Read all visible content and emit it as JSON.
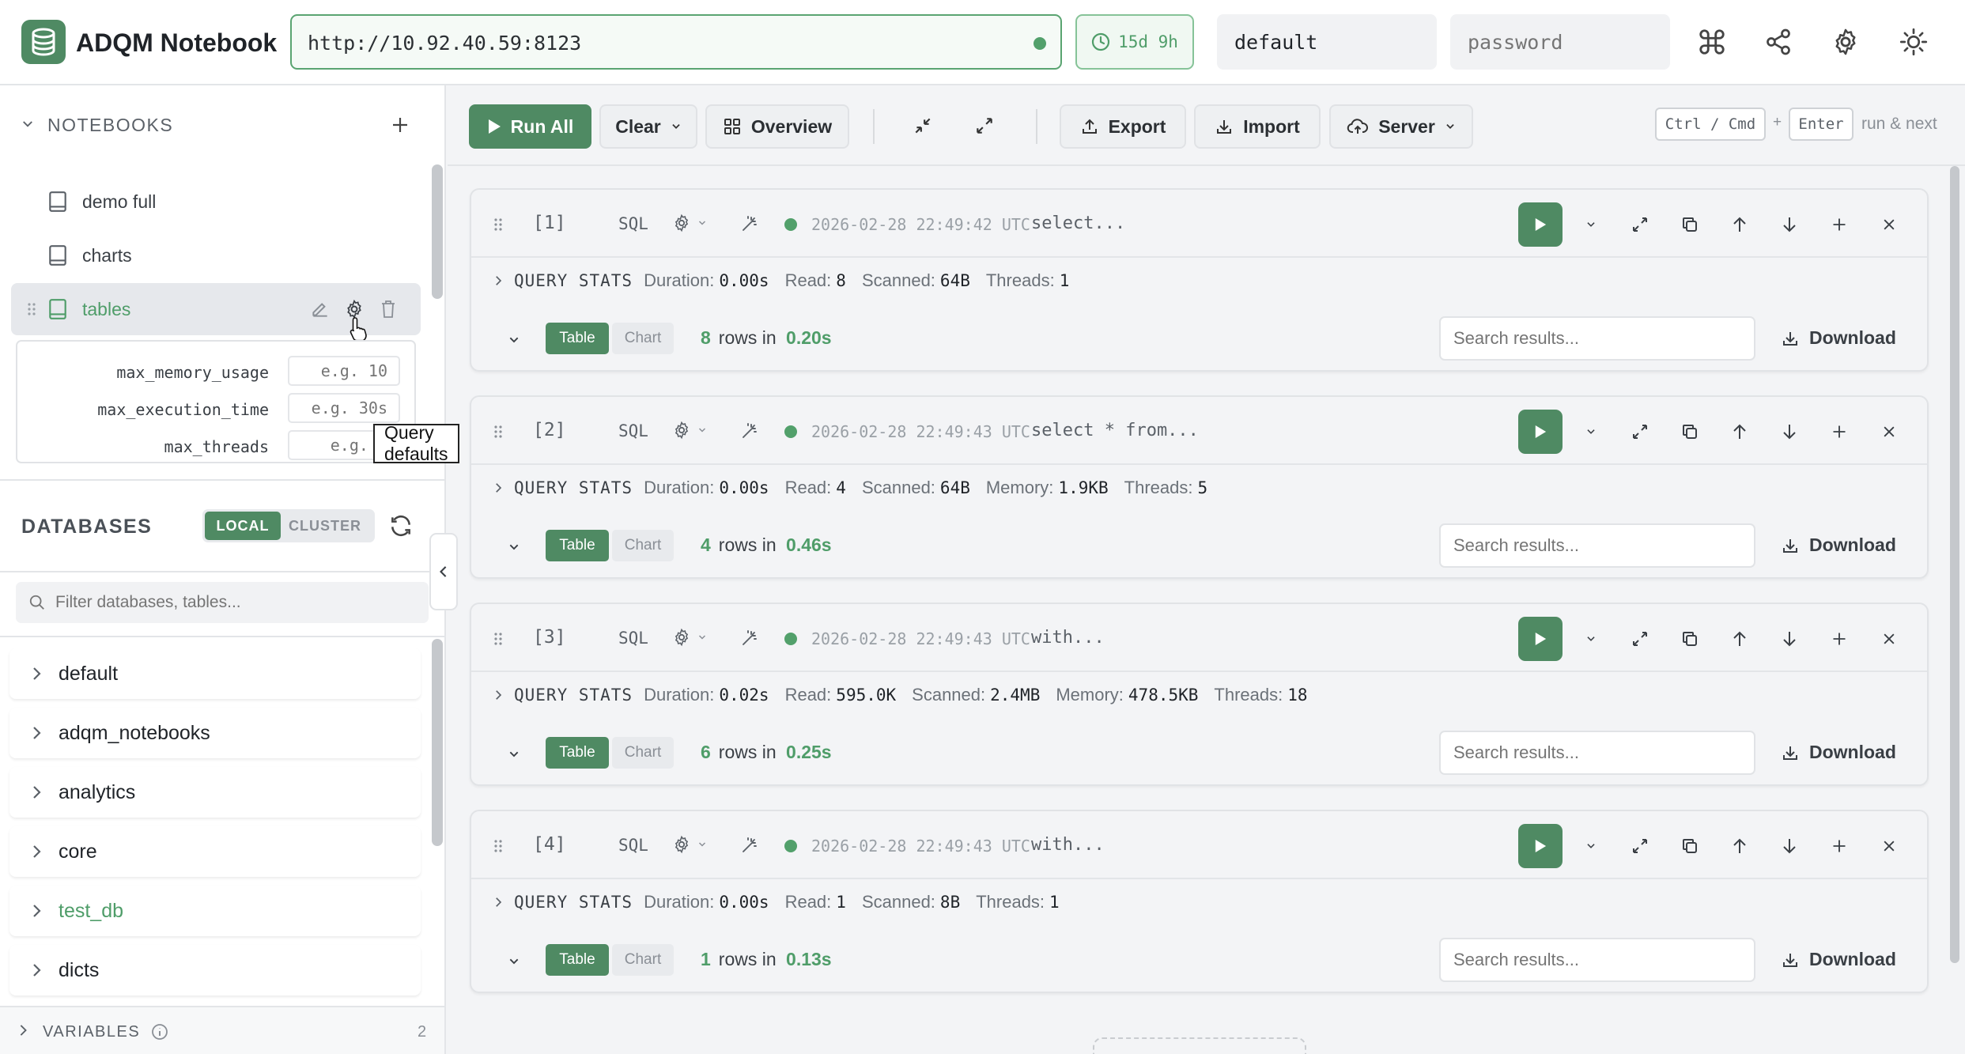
{
  "app": {
    "title": "ADQM Notebook"
  },
  "header": {
    "url": "http://10.92.40.59:8123",
    "uptime": "15d 9h",
    "username": "default",
    "password_placeholder": "password",
    "icons": [
      "command-icon",
      "share-icon",
      "settings-icon",
      "theme-sun-icon"
    ]
  },
  "sidebar": {
    "notebooks_title": "NOTEBOOKS",
    "notebooks": [
      {
        "label": "demo full"
      },
      {
        "label": "charts"
      },
      {
        "label": "tables",
        "active": true
      }
    ],
    "query_defaults": [
      {
        "key": "max_memory_usage",
        "placeholder": "e.g. 10"
      },
      {
        "key": "max_execution_time",
        "placeholder": "e.g. 30s"
      },
      {
        "key": "max_threads",
        "placeholder": "e.g. 4"
      }
    ],
    "tooltip": "Query defaults",
    "databases_title": "DATABASES",
    "toggle": {
      "local": "LOCAL",
      "cluster": "CLUSTER",
      "selected": "local"
    },
    "filter_placeholder": "Filter databases, tables...",
    "databases": [
      {
        "name": "default"
      },
      {
        "name": "adqm_notebooks"
      },
      {
        "name": "analytics"
      },
      {
        "name": "core"
      },
      {
        "name": "test_db",
        "highlight": true
      },
      {
        "name": "dicts"
      }
    ],
    "variables_title": "VARIABLES",
    "variables_count": "2"
  },
  "toolbar": {
    "run_all": "Run All",
    "clear": "Clear",
    "overview": "Overview",
    "export": "Export",
    "import": "Import",
    "server": "Server",
    "kbd_mod": "Ctrl / Cmd",
    "kbd_plus": "+",
    "kbd_enter": "Enter",
    "kbd_hint": "run & next"
  },
  "cells": [
    {
      "num": "[1]",
      "lang": "SQL",
      "time": "2026-02-28 22:49:42 UTC",
      "query": "select...",
      "stats_label": "QUERY STATS",
      "stats": [
        {
          "k": "Duration:",
          "v": "0.00s"
        },
        {
          "k": "Read:",
          "v": "8"
        },
        {
          "k": "Scanned:",
          "v": "64B"
        },
        {
          "k": "Threads:",
          "v": "1"
        }
      ],
      "rows": "8",
      "rows_text": "rows in",
      "elapsed": "0.20s"
    },
    {
      "num": "[2]",
      "lang": "SQL",
      "time": "2026-02-28 22:49:43 UTC",
      "query": "select * from...",
      "stats_label": "QUERY STATS",
      "stats": [
        {
          "k": "Duration:",
          "v": "0.00s"
        },
        {
          "k": "Read:",
          "v": "4"
        },
        {
          "k": "Scanned:",
          "v": "64B"
        },
        {
          "k": "Memory:",
          "v": "1.9KB"
        },
        {
          "k": "Threads:",
          "v": "5"
        }
      ],
      "rows": "4",
      "rows_text": "rows in",
      "elapsed": "0.46s"
    },
    {
      "num": "[3]",
      "lang": "SQL",
      "time": "2026-02-28 22:49:43 UTC",
      "query": "with...",
      "stats_label": "QUERY STATS",
      "stats": [
        {
          "k": "Duration:",
          "v": "0.02s"
        },
        {
          "k": "Read:",
          "v": "595.0K"
        },
        {
          "k": "Scanned:",
          "v": "2.4MB"
        },
        {
          "k": "Memory:",
          "v": "478.5KB"
        },
        {
          "k": "Threads:",
          "v": "18"
        }
      ],
      "rows": "6",
      "rows_text": "rows in",
      "elapsed": "0.25s"
    },
    {
      "num": "[4]",
      "lang": "SQL",
      "time": "2026-02-28 22:49:43 UTC",
      "query": "with...",
      "stats_label": "QUERY STATS",
      "stats": [
        {
          "k": "Duration:",
          "v": "0.00s"
        },
        {
          "k": "Read:",
          "v": "1"
        },
        {
          "k": "Scanned:",
          "v": "8B"
        },
        {
          "k": "Threads:",
          "v": "1"
        }
      ],
      "rows": "1",
      "rows_text": "rows in",
      "elapsed": "0.13s"
    }
  ],
  "result_view": {
    "table": "Table",
    "chart": "Chart",
    "search_placeholder": "Search results...",
    "download": "Download"
  },
  "colors": {
    "accent": "#4f8a63",
    "accent_text": "#4f9d69",
    "bg": "#f3f4f6"
  }
}
